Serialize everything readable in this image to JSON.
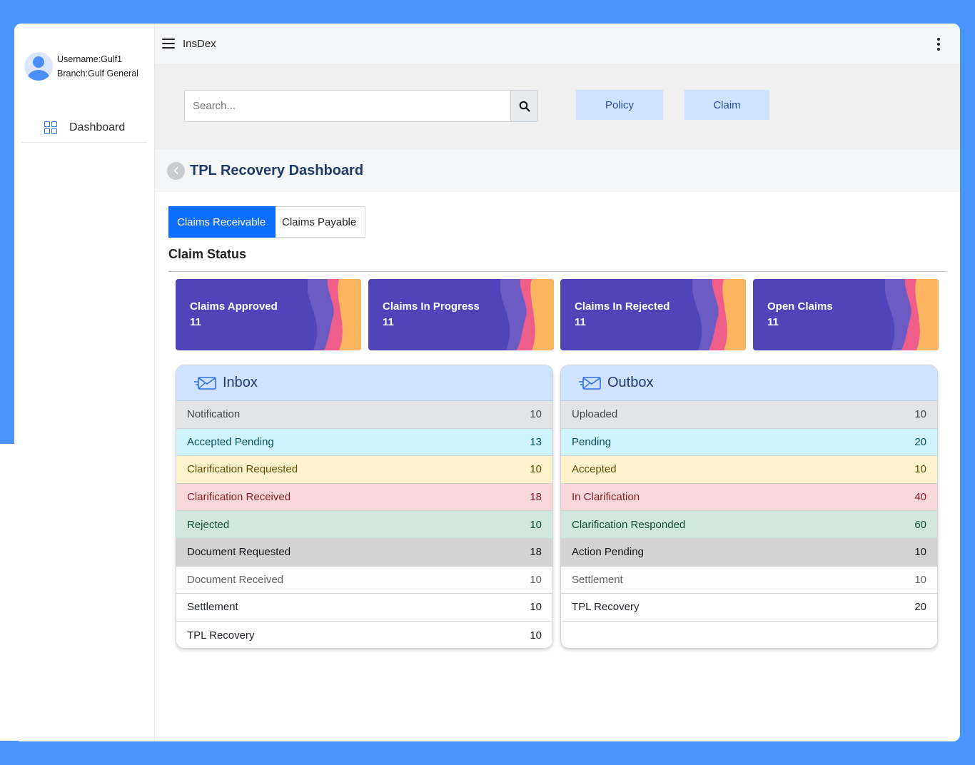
{
  "app": {
    "brand": "InsDex"
  },
  "user": {
    "username_line": "Username:Gulf1",
    "branch_line": "Branch:Gulf General"
  },
  "sidebar": {
    "items": [
      {
        "label": "Dashboard",
        "icon": "grid-icon"
      }
    ]
  },
  "search": {
    "placeholder": "Search...",
    "value": ""
  },
  "top_buttons": {
    "policy": "Policy",
    "claim": "Claim"
  },
  "page": {
    "title": "TPL Recovery Dashboard"
  },
  "tabs": [
    {
      "label": "Claims Receivable",
      "active": true
    },
    {
      "label": "Claims Payable",
      "active": false
    }
  ],
  "claim_status": {
    "title": "Claim Status",
    "cards": [
      {
        "label": "Claims Approved",
        "value": "11"
      },
      {
        "label": "Claims In Progress",
        "value": "11"
      },
      {
        "label": "Claims In Rejected",
        "value": "11"
      },
      {
        "label": "Open Claims",
        "value": "11"
      }
    ]
  },
  "inbox": {
    "title": "Inbox",
    "rows": [
      {
        "label": "Notification",
        "count": "10"
      },
      {
        "label": "Accepted Pending",
        "count": "13"
      },
      {
        "label": "Clarification Requested",
        "count": "10"
      },
      {
        "label": "Clarification Received",
        "count": "18"
      },
      {
        "label": "Rejected",
        "count": "10"
      },
      {
        "label": "Document Requested",
        "count": "18"
      },
      {
        "label": "Document Received",
        "count": "10"
      },
      {
        "label": "Settlement",
        "count": "10"
      },
      {
        "label": "TPL Recovery",
        "count": "10"
      }
    ]
  },
  "outbox": {
    "title": "Outbox",
    "rows": [
      {
        "label": "Uploaded",
        "count": "10"
      },
      {
        "label": "Pending",
        "count": "20"
      },
      {
        "label": "Accepted",
        "count": "10"
      },
      {
        "label": "In Clarification",
        "count": "40"
      },
      {
        "label": "Clarification Responded",
        "count": "60"
      },
      {
        "label": "Action Pending",
        "count": "10"
      },
      {
        "label": "Settlement",
        "count": "10"
      },
      {
        "label": "TPL Recovery",
        "count": "20"
      }
    ]
  },
  "colors": {
    "background": "#4A94FF",
    "card": "#5044B8",
    "tab_active": "#0D6EFD",
    "button_light": "#CFE2FF",
    "title": "#1F3A68"
  }
}
